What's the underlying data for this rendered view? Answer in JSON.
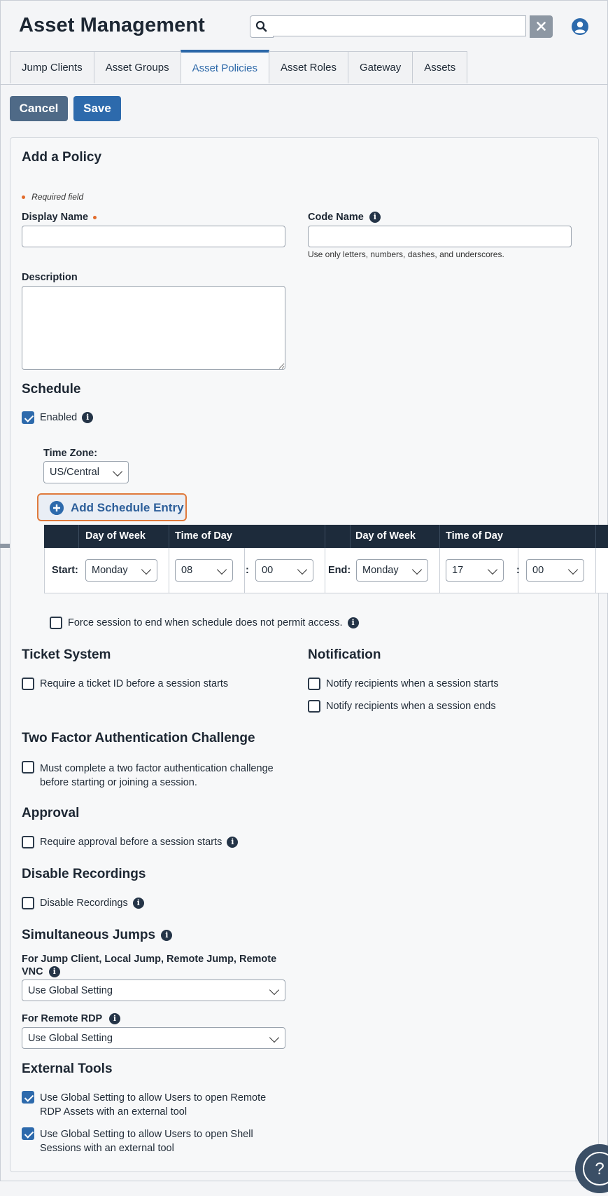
{
  "header": {
    "title": "Asset Management",
    "search": {
      "value": "",
      "placeholder": ""
    }
  },
  "tabs": [
    {
      "label": "Jump Clients",
      "active": false
    },
    {
      "label": "Asset Groups",
      "active": false
    },
    {
      "label": "Asset Policies",
      "active": true
    },
    {
      "label": "Asset Roles",
      "active": false
    },
    {
      "label": "Gateway",
      "active": false
    },
    {
      "label": "Assets",
      "active": false
    }
  ],
  "actions": {
    "cancel": "Cancel",
    "save": "Save"
  },
  "form": {
    "title": "Add a Policy",
    "required_note": "Required field",
    "display_name": {
      "label": "Display Name",
      "value": ""
    },
    "code_name": {
      "label": "Code Name",
      "value": "",
      "hint": "Use only letters, numbers, dashes, and underscores."
    },
    "description": {
      "label": "Description",
      "value": ""
    },
    "schedule": {
      "heading": "Schedule",
      "enabled_label": "Enabled",
      "enabled": true,
      "timezone_label": "Time Zone:",
      "timezone": "US/Central",
      "add_entry": "Add Schedule Entry",
      "columns": {
        "day": "Day of Week",
        "time": "Time of Day"
      },
      "start_label": "Start:",
      "end_label": "End:",
      "separator": ":",
      "start": {
        "day": "Monday",
        "hour": "08",
        "minute": "00"
      },
      "end": {
        "day": "Monday",
        "hour": "17",
        "minute": "00"
      },
      "force_end_label": "Force session to end when schedule does not permit access.",
      "force_end": false
    },
    "ticket": {
      "heading": "Ticket System",
      "label": "Require a ticket ID before a session starts",
      "checked": false
    },
    "notification": {
      "heading": "Notification",
      "starts_label": "Notify recipients when a session starts",
      "ends_label": "Notify recipients when a session ends",
      "starts": false,
      "ends": false
    },
    "two_factor": {
      "heading": "Two Factor Authentication Challenge",
      "label_line1": "Must complete a two factor authentication challenge",
      "label_line2": "before starting or joining a session.",
      "checked": false
    },
    "approval": {
      "heading": "Approval",
      "label": "Require approval before a session starts",
      "checked": false
    },
    "recordings": {
      "heading": "Disable Recordings",
      "label": "Disable Recordings",
      "checked": false
    },
    "jumps": {
      "heading": "Simultaneous Jumps",
      "client_label_line1": "For Jump Client, Local Jump, Remote Jump, Remote",
      "client_label_line2": "VNC",
      "client_value": "Use Global Setting",
      "rdp_label": "For Remote RDP",
      "rdp_value": "Use Global Setting"
    },
    "external_tools": {
      "heading": "External Tools",
      "rdp_line1": "Use Global Setting to allow Users to open Remote",
      "rdp_line2": "RDP Assets with an external tool",
      "shell_line1": "Use Global Setting to allow Users to open Shell",
      "shell_line2": "Sessions with an external tool",
      "rdp_checked": true,
      "shell_checked": true
    }
  },
  "colors": {
    "accent": "#2d6aac",
    "cancel": "#4f6a87",
    "header_dark": "#1d2b3b",
    "required": "#e26b2b",
    "focus": "#e07a3c"
  },
  "icons": [
    "search-icon",
    "close-icon",
    "user-icon",
    "info-icon",
    "plus-circle-icon",
    "chevron-down-icon",
    "help-icon"
  ]
}
